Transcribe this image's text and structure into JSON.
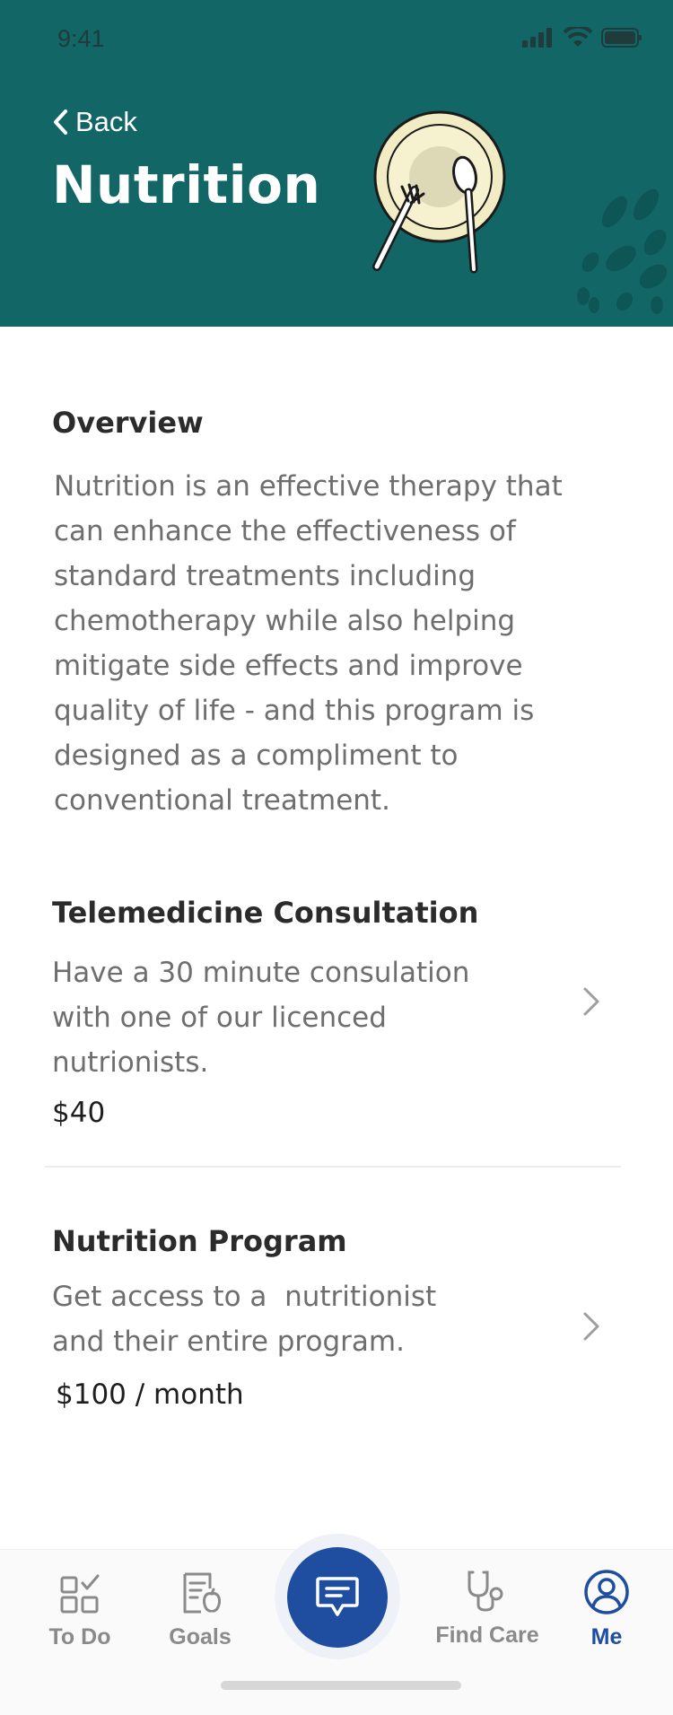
{
  "status_bar": {
    "time": "9:41"
  },
  "header": {
    "back_label": "Back",
    "title": "Nutrition",
    "background_color": "#126766"
  },
  "overview": {
    "title": "Overview",
    "lines": [
      "Nutrition is an effective therapy that",
      "can enhance the effectiveness of",
      "standard treatments including",
      "chemotherapy while also helping",
      "mitigate side effects and improve",
      "quality of life - and this program is",
      "designed as a compliment to",
      "conventional treatment."
    ]
  },
  "services": [
    {
      "title": "Telemedicine Consultation",
      "desc_lines": [
        "Have a 30 minute consulation",
        "with one of our licenced",
        "nutrionists."
      ],
      "price": "$40",
      "icon": "chevron-right-icon"
    },
    {
      "title": "Nutrition Program",
      "desc_lines": [
        "Get access to a  nutritionist",
        "and their entire program."
      ],
      "price": "$100 / month",
      "icon": "chevron-right-icon"
    }
  ],
  "tabbar": {
    "tabs": [
      {
        "label": "To Do",
        "icon": "todo-icon"
      },
      {
        "label": "Goals",
        "icon": "goals-icon"
      },
      {
        "label": "Find Care",
        "icon": "stethoscope-icon"
      },
      {
        "label": "Me",
        "icon": "profile-icon",
        "active": true
      }
    ],
    "chat_icon": "chat-icon",
    "accent_color": "#1f4ea0"
  }
}
